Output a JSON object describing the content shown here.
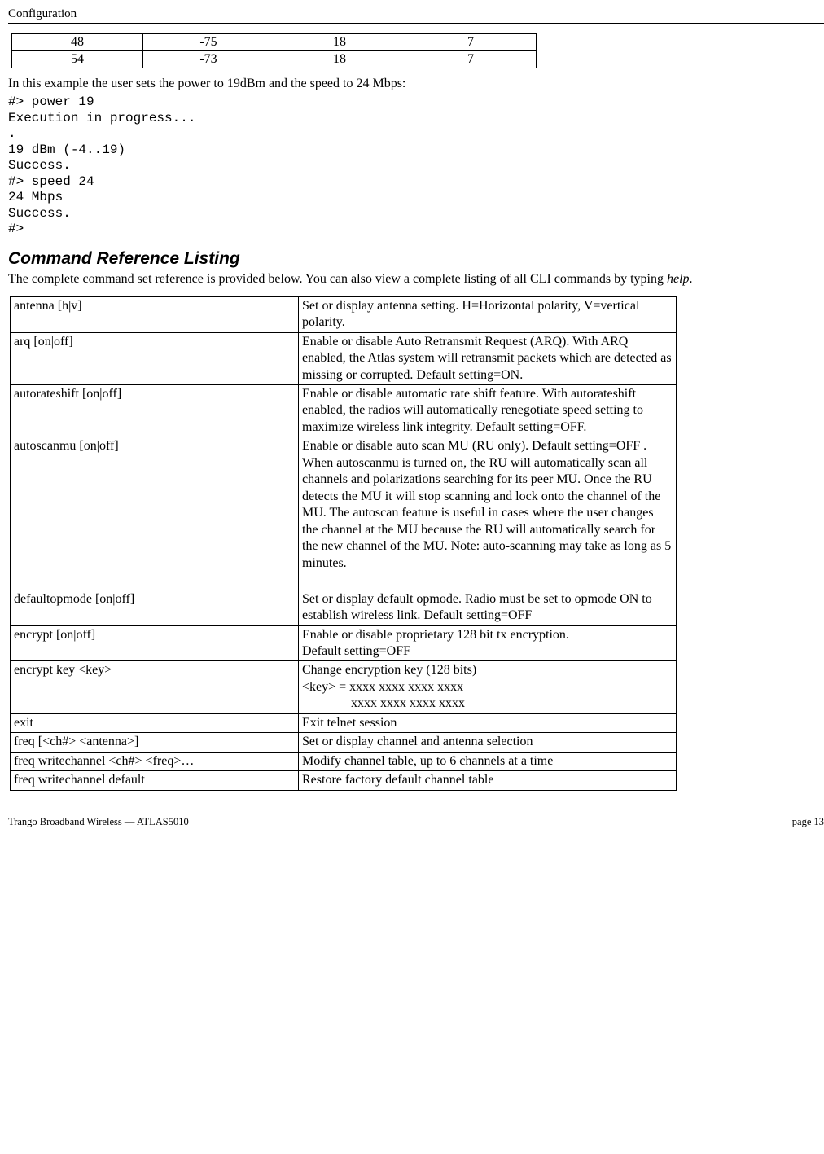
{
  "header": {
    "title": "Configuration"
  },
  "num_table": {
    "rows": [
      {
        "a": "48",
        "b": "-75",
        "c": "18",
        "d": "7"
      },
      {
        "a": "54",
        "b": "-73",
        "c": "18",
        "d": "7"
      }
    ]
  },
  "intro_line": "In this example the user sets the power to 19dBm and the speed to 24 Mbps:",
  "console": "#> power 19\nExecution in progress...\n.\n19 dBm (-4..19)\nSuccess.\n#> speed 24\n24 Mbps\nSuccess.\n#>",
  "section_title": "Command Reference Listing",
  "section_intro_pre": "The complete command set reference is provided below.  You can also view a complete listing of all CLI commands by typing ",
  "section_intro_em": "help",
  "section_intro_post": ".",
  "cmd_table": {
    "rows": [
      {
        "cmd": "antenna [h|v]",
        "desc": "Set or display antenna setting.  H=Horizontal polarity, V=vertical polarity."
      },
      {
        "cmd": "arq [on|off]",
        "desc": "Enable or disable Auto Retransmit Request (ARQ).  With ARQ enabled, the Atlas system will retransmit packets which are detected as missing or corrupted.  Default setting=ON."
      },
      {
        "cmd": "autorateshift [on|off]",
        "desc": "Enable or disable automatic rate shift feature.  With autorateshift enabled, the radios will automatically renegotiate speed setting to maximize wireless link integrity.  Default setting=OFF."
      },
      {
        "cmd": "autoscanmu [on|off]",
        "desc": "Enable or disable auto scan MU (RU only).  Default setting=OFF .  When autoscanmu is turned on, the RU will automatically scan all channels and polarizations searching for its peer MU.  Once the RU detects the MU it will stop scanning and lock onto the channel of the MU.  The autoscan feature is useful in cases where the user changes the channel at the MU because the RU will automatically search for the new channel of the MU.  Note:  auto-scanning may take as long as 5 minutes.\n "
      },
      {
        "cmd": "defaultopmode [on|off]",
        "desc": "Set or display default opmode.   Radio must be set to opmode ON to establish wireless link.  Default setting=OFF"
      },
      {
        "cmd": "encrypt [on|off]",
        "desc": "Enable or disable proprietary 128 bit tx encryption.\nDefault setting=OFF"
      },
      {
        "cmd": "encrypt key <key>",
        "desc_line1": "Change encryption key (128 bits)",
        "desc_line2": "<key> = xxxx xxxx xxxx xxxx",
        "desc_line3": "xxxx xxxx xxxx xxxx"
      },
      {
        "cmd": "exit",
        "desc": "Exit telnet session"
      },
      {
        "cmd": "freq [<ch#> <antenna>]",
        "desc": "Set or display channel and antenna selection"
      },
      {
        "cmd": "freq writechannel <ch#> <freq>…",
        "desc": "Modify channel table, up to 6 channels at a time"
      },
      {
        "cmd": "freq writechannel default",
        "desc": "Restore factory default channel table"
      }
    ]
  },
  "footer": {
    "left": "Trango Broadband Wireless — ATLAS5010",
    "right": "page 13"
  }
}
